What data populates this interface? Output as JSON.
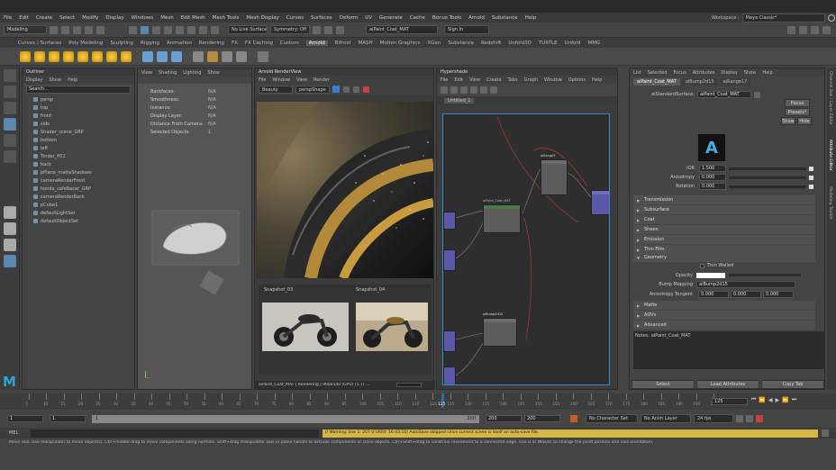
{
  "menubar": [
    "File",
    "Edit",
    "Create",
    "Select",
    "Modify",
    "Display",
    "Windows",
    "Mesh",
    "Edit Mesh",
    "Mesh Tools",
    "Mesh Display",
    "Curves",
    "Surfaces",
    "Deform",
    "UV",
    "Generate",
    "Cache",
    "Bonus Tools",
    "Arnold",
    "Substance",
    "Help"
  ],
  "workspace_label": "Workspace :",
  "workspace_value": "Maya Classic*",
  "mode_dropdown": "Modeling",
  "live_surface": "No Live Surface",
  "symmetry": "Symmetry: Off",
  "render_name": "aiPaint_Coat_MAT",
  "sign_in": "Sign In",
  "shelf_tabs": [
    "Curves / Surfaces",
    "Poly Modeling",
    "Sculpting",
    "Rigging",
    "Animation",
    "Rendering",
    "FX",
    "FX Caching",
    "Custom",
    "Arnold",
    "Bifrost",
    "MASH",
    "Motion Graphics",
    "XGen",
    "Substance",
    "Redshift",
    "Unfold3D",
    "TURTLE",
    "Unfold",
    "MMG"
  ],
  "shelf_active": "Arnold",
  "outliner": {
    "title": "Outliner",
    "menu": [
      "Display",
      "Show",
      "Help"
    ],
    "search": "Search...",
    "items": [
      "persp",
      "top",
      "front",
      "side",
      "Shader_scene_GRP",
      "bottom",
      "left",
      "Tinder_P01",
      "back",
      "pPlane_matteShadows",
      "cameraRenderFront",
      "honda_cafeRacer_GRP",
      "cameraRenderBack",
      "pCube1",
      "defaultLightSet",
      "defaultObjectSet"
    ]
  },
  "viewport": {
    "menu": [
      "View",
      "Shading",
      "Lighting",
      "Show"
    ],
    "info": [
      {
        "k": "Backfaces:",
        "v": "N/A"
      },
      {
        "k": "Smoothness:",
        "v": "N/A"
      },
      {
        "k": "Instance:",
        "v": "N/A"
      },
      {
        "k": "Display Layer:",
        "v": "N/A"
      },
      {
        "k": "Distance From Camera:",
        "v": "N/A"
      },
      {
        "k": "Selected Objects:",
        "v": "1"
      }
    ]
  },
  "renderview": {
    "title": "Arnold RenderView",
    "menu": [
      "File",
      "Window",
      "View",
      "Render"
    ],
    "camera": "perspShape",
    "snapshots": [
      "Snapshot_03",
      "Snapshot_04"
    ],
    "status": "aiPaint_Coat_MAT | Rendering | 960x540 (GPU) (5.7) ..."
  },
  "hypershade": {
    "title": "Hypershade",
    "menu": [
      "File",
      "Edit",
      "View",
      "Create",
      "Tabs",
      "Graph",
      "Window",
      "Options",
      "Help"
    ],
    "tab": "Untitled_1",
    "node_labels": [
      "aiRange5",
      "aiPaint_Coat_MAT",
      "aiBump2d15",
      "aiRange17"
    ]
  },
  "attr_editor": {
    "menu": [
      "List",
      "Selected",
      "Focus",
      "Attributes",
      "Display",
      "Show",
      "Help"
    ],
    "tabs": [
      "aiPaint_Coat_MAT",
      "aiBump2d15",
      "aiRange17"
    ],
    "type_label": "aiStandardSurface:",
    "node_name": "aiPaint_Coat_MAT",
    "focus_btn": "Focus",
    "presets_btn": "Presets*",
    "show_btn": "Show",
    "hide_btn": "Hide",
    "logo_letter": "A",
    "rows": [
      {
        "label": "IOR",
        "value": "1.500"
      },
      {
        "label": "Anisotropy",
        "value": "0.000"
      },
      {
        "label": "Rotation",
        "value": "0.000"
      }
    ],
    "sections": [
      "Transmission",
      "Subsurface",
      "Coat",
      "Sheen",
      "Emission",
      "Thin Film"
    ],
    "geometry": "Geometry",
    "thin_walled": "Thin Walled",
    "opacity_label": "Opacity",
    "bump_label": "Bump Mapping",
    "bump_value": "aiBump2d15",
    "aniso_tangent_label": "Anisotropy Tangent",
    "aniso_tangent_values": [
      "0.000",
      "0.000",
      "0.000"
    ],
    "more_sections": [
      "Matte",
      "AOVs",
      "Advanced"
    ],
    "notes": "Notes: aiPaint_Coat_MAT",
    "buttons": [
      "Select",
      "Load Attributes",
      "Copy Tab"
    ]
  },
  "timeline": {
    "ticks": [
      "5",
      "10",
      "15",
      "20",
      "25",
      "30",
      "35",
      "40",
      "45",
      "50",
      "55",
      "60",
      "65",
      "70",
      "75",
      "80",
      "85",
      "90",
      "95",
      "100",
      "105",
      "110",
      "115",
      "120",
      "125",
      "130",
      "135",
      "140",
      "145",
      "150",
      "155",
      "160",
      "165",
      "170",
      "175",
      "180",
      "185",
      "190",
      "195",
      "200"
    ],
    "current_marker": "125",
    "current_frame": "125"
  },
  "range": {
    "start": "1",
    "start2": "1",
    "bar_start": "1",
    "bar_end": "200",
    "end": "200",
    "end2": "200",
    "char_set": "No Character Set",
    "anim_layer": "No Anim Layer",
    "fps": "24 fps"
  },
  "cmdline": {
    "label": "MEL",
    "warning": "// Warning: line 1: 207 (FURRY: 16:43:10) AutoSave skipped since current scene is itself an auto-save file."
  },
  "helpline": "Move Tool: Use manipulator to move object(s). Ctrl+middle-drag to move components along normals. Shift+drag manipulator axis or plane handle to extrude components or clone objects. Ctrl+Shift+drag to constrain movement to a connected edge. Use D or INSERT to change the pivot position and axis orientation.",
  "right_tabs": [
    "Channel Box / Layer Editor",
    "Attribute Editor",
    "Modeling Toolkit"
  ]
}
